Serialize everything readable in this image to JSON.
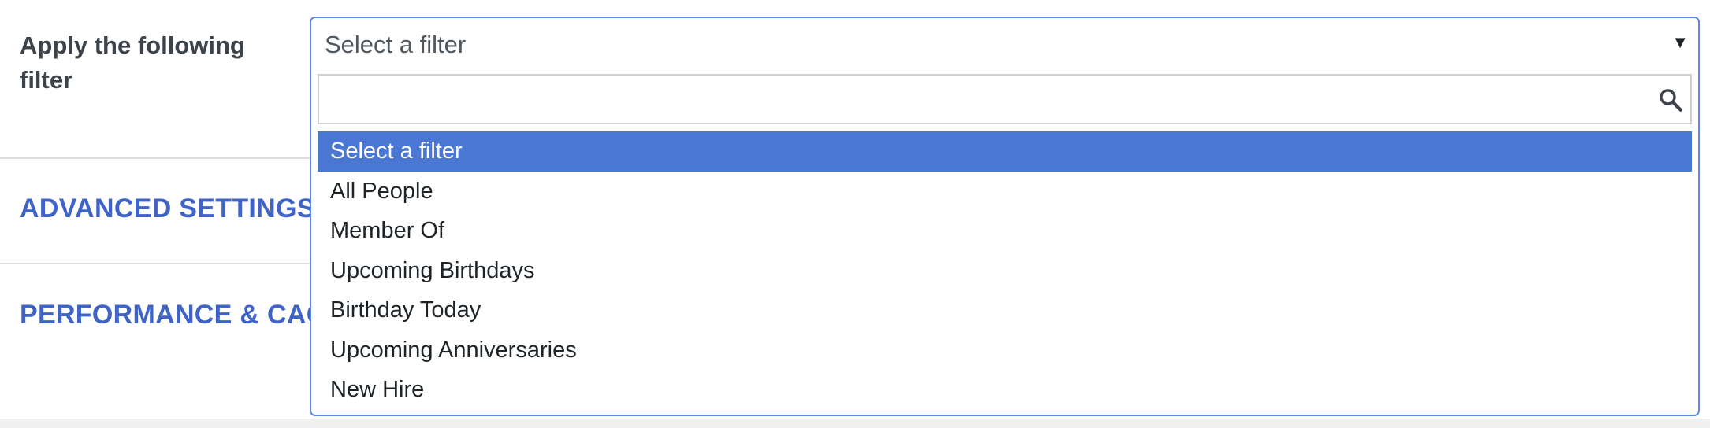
{
  "filter_row": {
    "label": "Apply the following filter"
  },
  "sections": {
    "advanced": "ADVANCED SETTINGS",
    "performance": "PERFORMANCE & CACHING"
  },
  "select": {
    "value": "Select a filter",
    "arrow_icon": "dropdown-arrow-icon",
    "search": {
      "value": "",
      "placeholder": "",
      "icon": "search-icon"
    },
    "highlighted_option": "Select a filter",
    "options": [
      "Select a filter",
      "All People",
      "Member Of",
      "Upcoming Birthdays",
      "Birthday Today",
      "Upcoming Anniversaries",
      "New Hire"
    ]
  },
  "colors": {
    "heading_accent": "#3f63c7",
    "highlight": "#4a76d4",
    "focus_border": "#5b8ae0"
  }
}
